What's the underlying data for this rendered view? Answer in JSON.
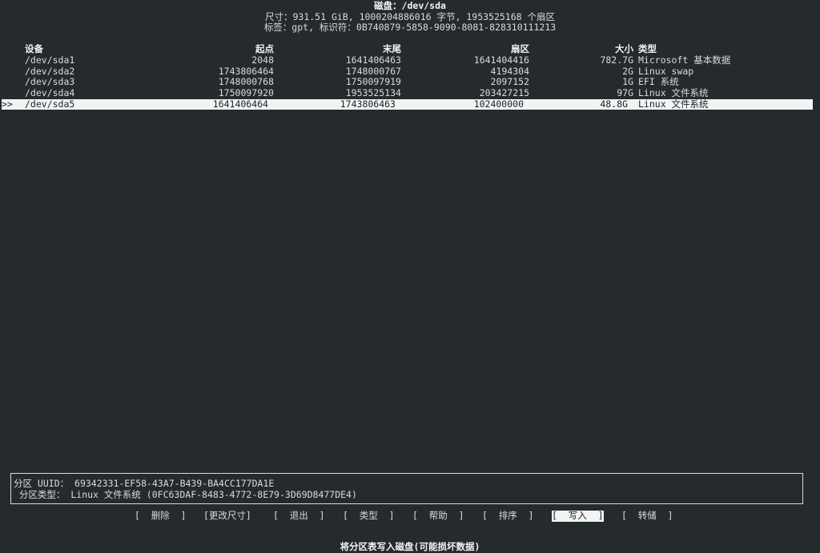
{
  "header": {
    "title": "磁盘：/dev/sda",
    "size_line": "尺寸：931.51 GiB, 1000204886016 字节, 1953525168 个扇区",
    "label_line": "标签：gpt, 标识符：0B740879-5858-9090-8081-828310111213"
  },
  "columns": {
    "device": "设备",
    "start": "起点",
    "end": "末尾",
    "sectors": "扇区",
    "size": "大小",
    "type": "类型"
  },
  "partitions": [
    {
      "device": "/dev/sda1",
      "start": "2048",
      "end": "1641406463",
      "sectors": "1641404416",
      "size": "782.7G",
      "type": "Microsoft 基本数据"
    },
    {
      "device": "/dev/sda2",
      "start": "1743806464",
      "end": "1748000767",
      "sectors": "4194304",
      "size": "2G",
      "type": "Linux swap"
    },
    {
      "device": "/dev/sda3",
      "start": "1748000768",
      "end": "1750097919",
      "sectors": "2097152",
      "size": "1G",
      "type": "EFI 系统"
    },
    {
      "device": "/dev/sda4",
      "start": "1750097920",
      "end": "1953525134",
      "sectors": "203427215",
      "size": "97G",
      "type": "Linux 文件系统"
    },
    {
      "device": "/dev/sda5",
      "start": "1641406464",
      "end": "1743806463",
      "sectors": "102400000",
      "size": "48.8G",
      "type": "Linux 文件系统"
    }
  ],
  "selected_marker": ">>",
  "info": {
    "uuid_line": "分区 UUID： 69342331-EF58-43A7-B439-BA4CC177DA1E",
    "type_line": " 分区类型： Linux 文件系统 (0FC63DAF-8483-4772-8E79-3D69D8477DE4)"
  },
  "menu": {
    "delete": "[  删除  ]",
    "resize": "[更改尺寸]",
    "quit": "[  退出  ]",
    "type": "[  类型  ]",
    "help": "[  帮助  ]",
    "sort": "[  排序  ]",
    "write": "[  写入  ]",
    "dump": "[  转储  ]"
  },
  "status": "将分区表写入磁盘(可能损坏数据)",
  "colors": {
    "background": "#252a2d",
    "foreground": "#d8dcde",
    "highlight": "#f3f3f3"
  }
}
